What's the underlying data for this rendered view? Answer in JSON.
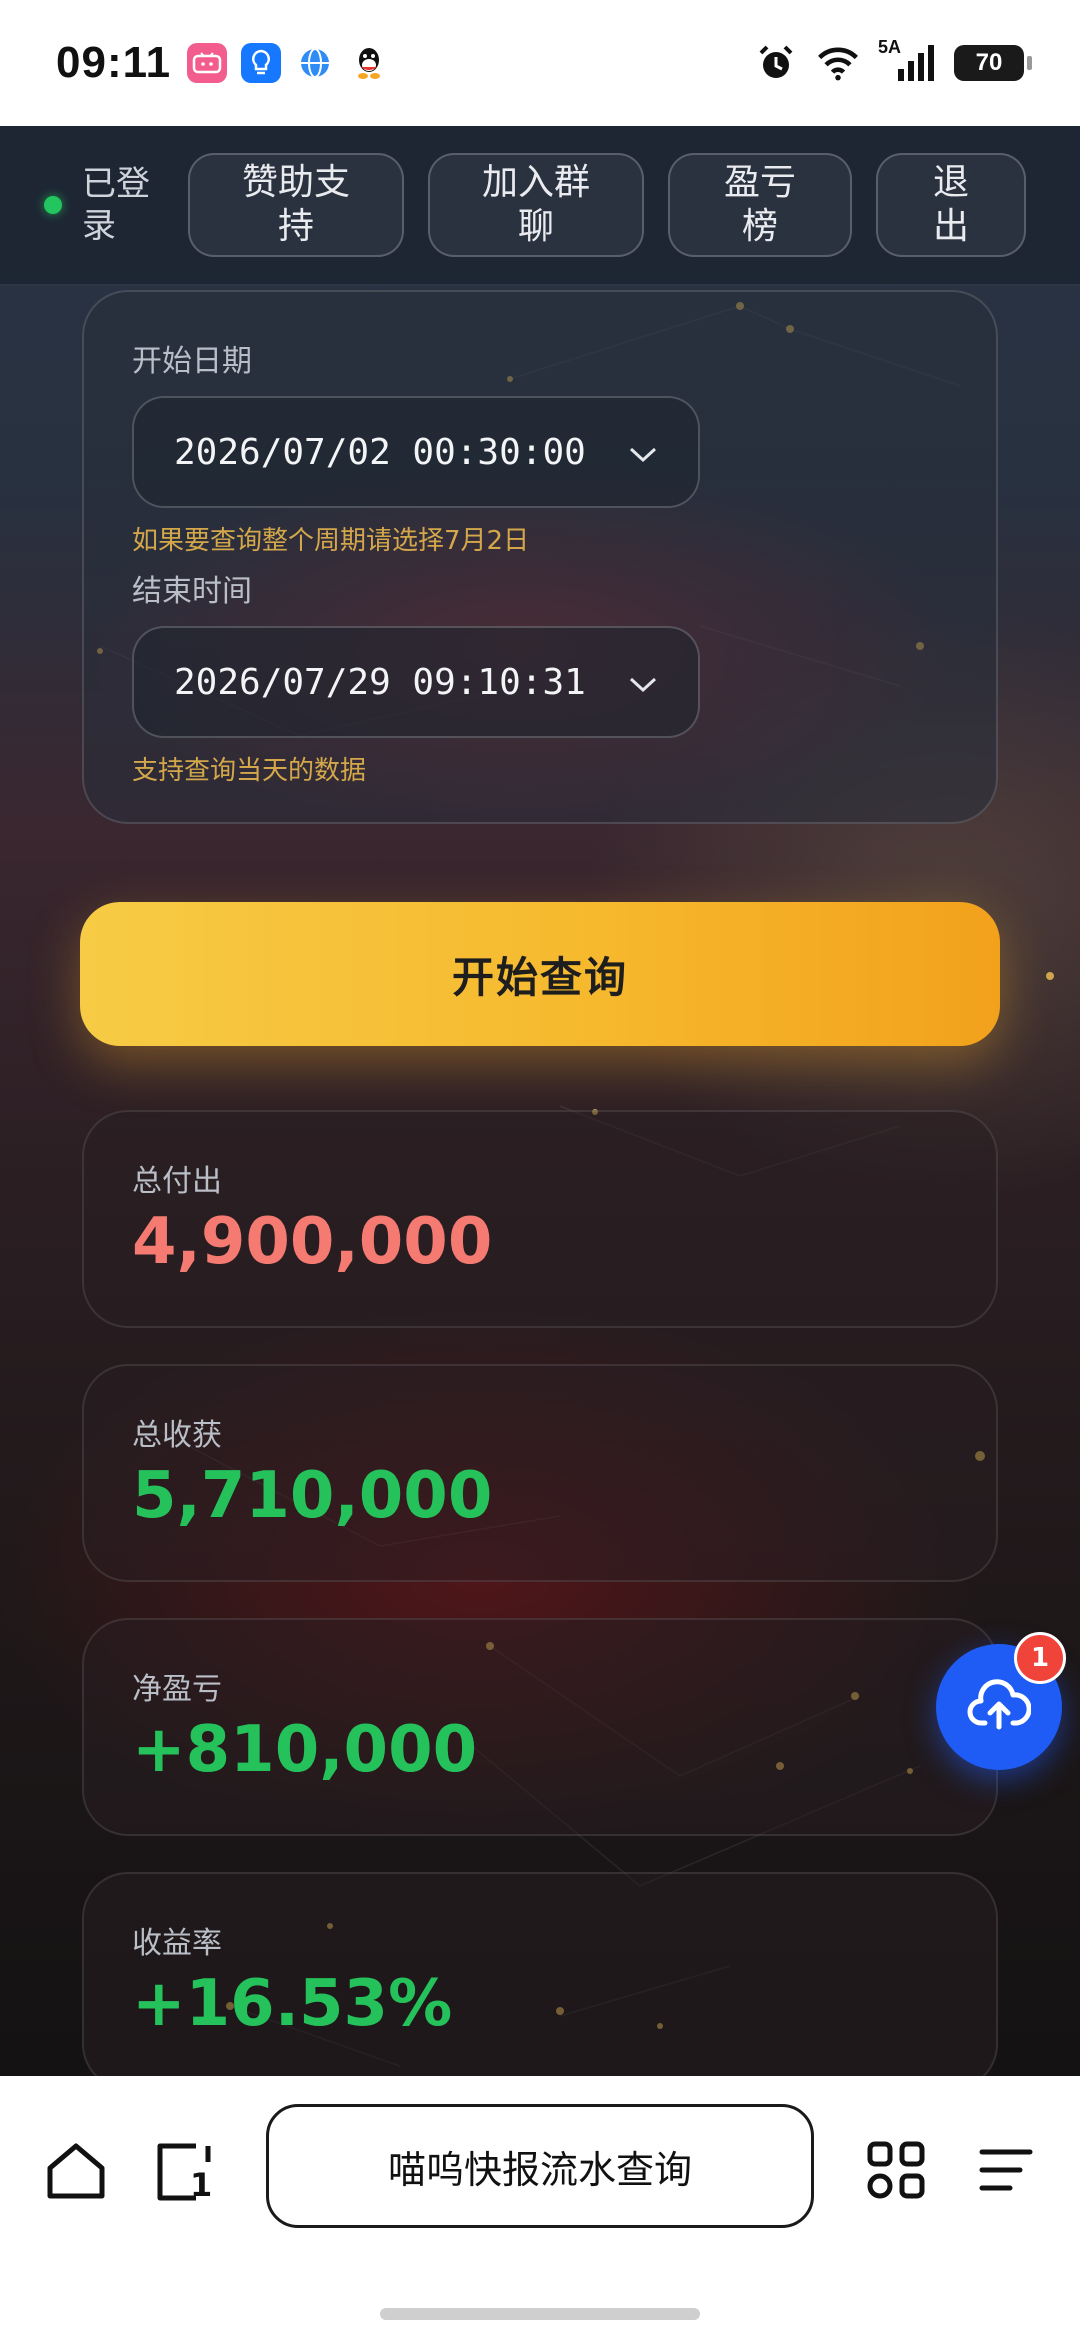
{
  "status_bar": {
    "time": "09:11",
    "apps": [
      {
        "icon": "bilibili-icon",
        "label": "bili",
        "color": "#f25d8e"
      },
      {
        "icon": "bulb-app-icon",
        "label": "",
        "color": "#1677ff"
      },
      {
        "icon": "globe-app-icon",
        "label": "",
        "color": "#2f8cf5"
      },
      {
        "icon": "qq-icon",
        "label": "",
        "color": "#111111"
      }
    ],
    "network": "5A",
    "battery": "70"
  },
  "navbar": {
    "login_status": "已登录",
    "login_lines": [
      "已登",
      "录"
    ],
    "buttons": [
      {
        "label_lines": [
          "赞助支",
          "持"
        ]
      },
      {
        "label_lines": [
          "加入群",
          "聊"
        ]
      },
      {
        "label_lines": [
          "盈亏",
          "榜"
        ]
      },
      {
        "label_lines": [
          "退",
          "出"
        ]
      }
    ]
  },
  "date_form": {
    "start_label": "开始日期",
    "start_value": "2026/07/02 00:30:00",
    "start_hint": "如果要查询整个周期请选择7月2日",
    "end_label": "结束时间",
    "end_value": "2026/07/29 09:10:31",
    "end_hint": "支持查询当天的数据"
  },
  "query_button": "开始查询",
  "stats": {
    "total_paid": {
      "label": "总付出",
      "value": "4,900,000",
      "color": "#f47a72"
    },
    "total_gain": {
      "label": "总收获",
      "value": "5,710,000",
      "color": "#25c15a"
    },
    "net_profit": {
      "label": "净盈亏",
      "value": "+810,000",
      "color": "#25c15a"
    },
    "return_rate": {
      "label": "收益率",
      "value": "+16.53%",
      "color": "#25c15a"
    }
  },
  "fab": {
    "icon": "cloud-upload-icon",
    "badge": "1"
  },
  "browser": {
    "page_title": "喵呜快报流水查询",
    "tab_count": "1"
  }
}
